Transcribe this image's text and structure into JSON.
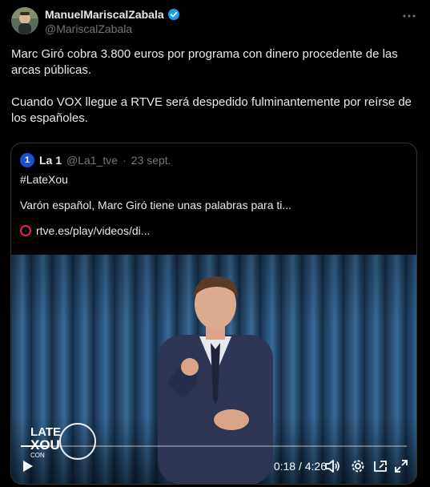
{
  "author": {
    "display_name": "ManuelMariscalZabala",
    "handle": "@MariscalZabala"
  },
  "tweet": {
    "text": "Marc Giró cobra 3.800 euros por programa con dinero procedente de las arcas públicas.\n\nCuando VOX llegue a RTVE será despedido fulminantemente por reírse de los españoles."
  },
  "quote": {
    "avatar_label": "1",
    "name": "La 1",
    "handle": "@La1_tve",
    "separator": "·",
    "date": "23 sept.",
    "hashtag": "#LateXou",
    "body": "Varón español, Marc Giró tiene unas palabras para ti...",
    "link": "rtve.es/play/videos/di..."
  },
  "video": {
    "logo_line1": "LATE",
    "logo_line2": "XOU",
    "logo_line3": "CON",
    "time_display": "0:18 / 4:26",
    "progress_fraction": 0.068
  },
  "colors": {
    "background": "#000000",
    "text": "#e7e9ea",
    "muted": "#71767b",
    "verified": "#1d9bf0",
    "border": "#2f3336"
  }
}
